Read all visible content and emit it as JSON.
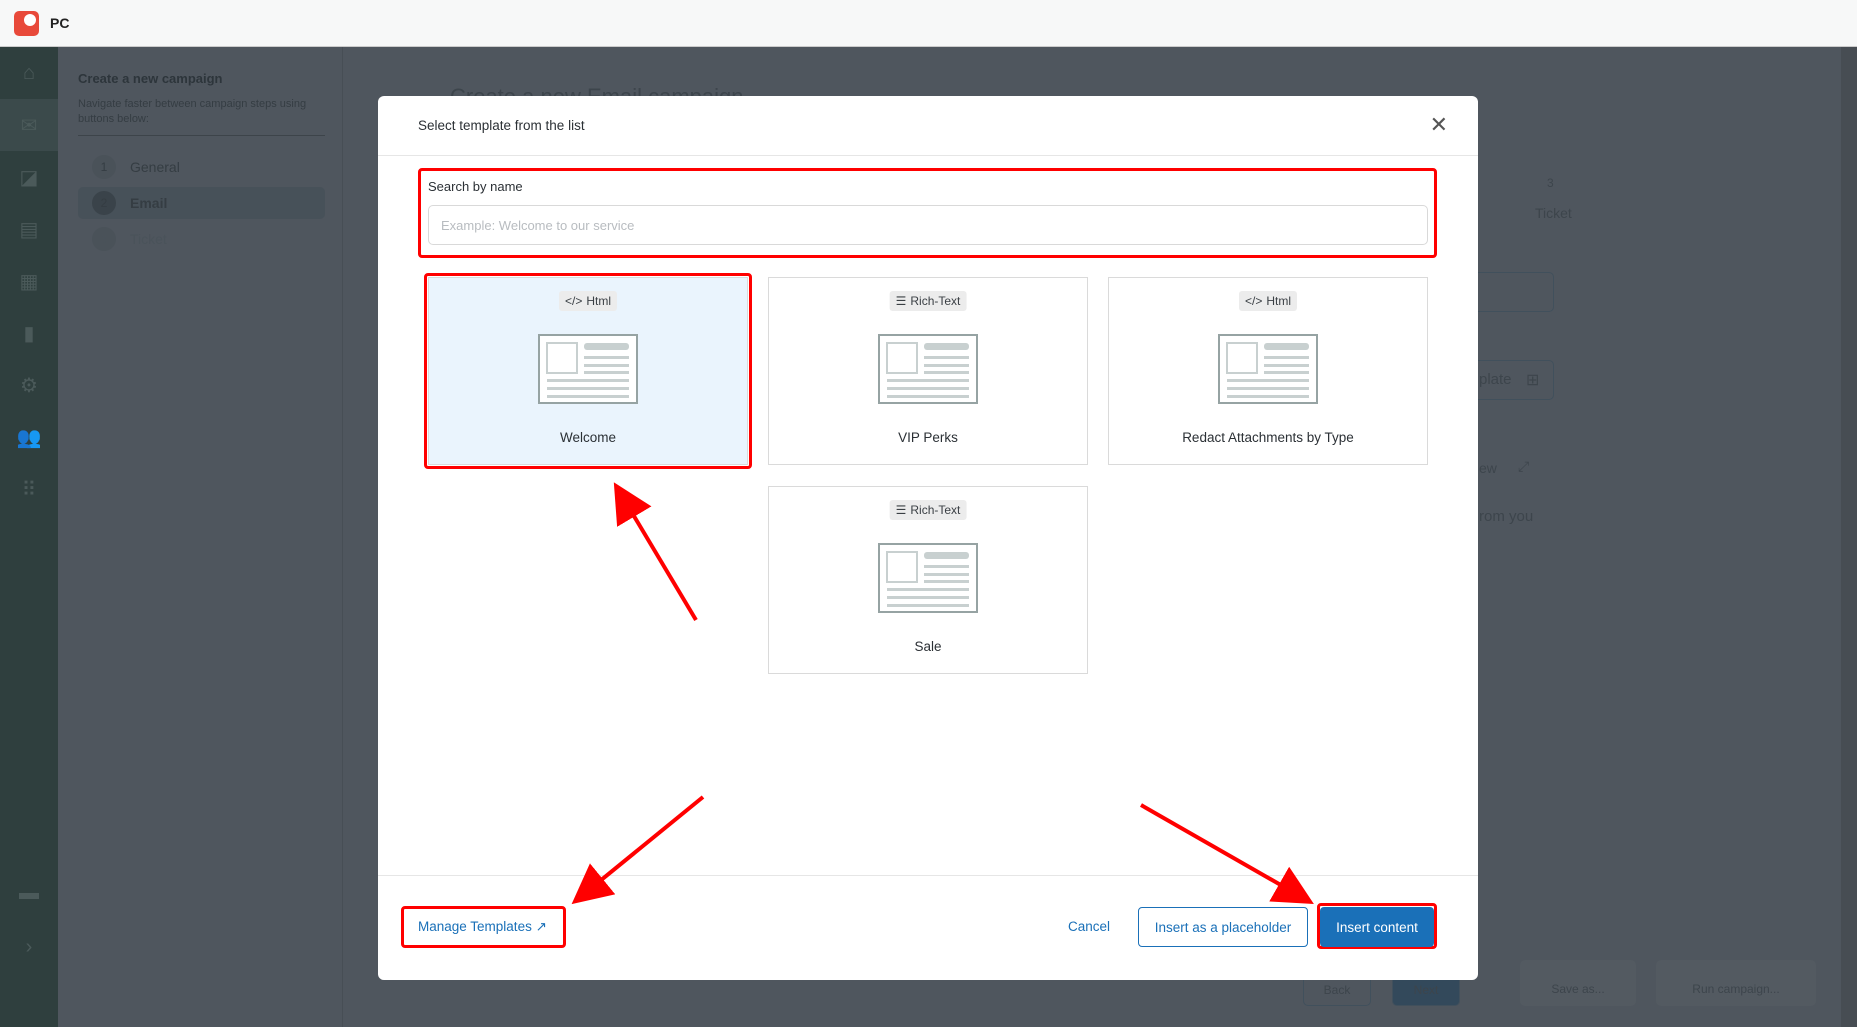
{
  "app": {
    "title": "PC"
  },
  "nav": {
    "icons": [
      "home-icon",
      "mail-icon",
      "shapes-icon",
      "inbox-icon",
      "widgets-add-icon",
      "bar-chart-icon",
      "gear-icon",
      "users-icon",
      "apps-grid-icon",
      "chat-icon",
      "chevron-right-icon"
    ]
  },
  "panel": {
    "title": "Create a new campaign",
    "subtitle": "Navigate faster between campaign steps using buttons below:",
    "steps": [
      {
        "num": "1",
        "label": "General"
      },
      {
        "num": "2",
        "label": "Email"
      },
      {
        "num": "3",
        "label": "Ticket"
      }
    ]
  },
  "background": {
    "page_title": "Create a new Email campaign",
    "step3_num": "3",
    "step3_label": "Ticket",
    "template_btn_fragment": "plate",
    "preview_fragment": "ew",
    "body_fragment": "rom you",
    "back": "Back",
    "next": "Next",
    "save_as": "Save as...",
    "run": "Run campaign..."
  },
  "modal": {
    "title": "Select template from the list",
    "search": {
      "label": "Search by name",
      "placeholder": "Example: Welcome to our service",
      "value": ""
    },
    "templates": [
      {
        "type": "Html",
        "name": "Welcome",
        "selected": true
      },
      {
        "type": "Rich-Text",
        "name": "VIP Perks",
        "selected": false
      },
      {
        "type": "Html",
        "name": "Redact Attachments by Type",
        "selected": false
      },
      {
        "type": "Rich-Text",
        "name": "Sale",
        "selected": false
      }
    ],
    "footer": {
      "manage": "Manage Templates",
      "cancel": "Cancel",
      "placeholder_btn": "Insert as a placeholder",
      "insert": "Insert content"
    }
  },
  "colors": {
    "accent": "#1a70b8",
    "annotation": "#ff0000",
    "selected_bg": "#eaf4fd"
  }
}
